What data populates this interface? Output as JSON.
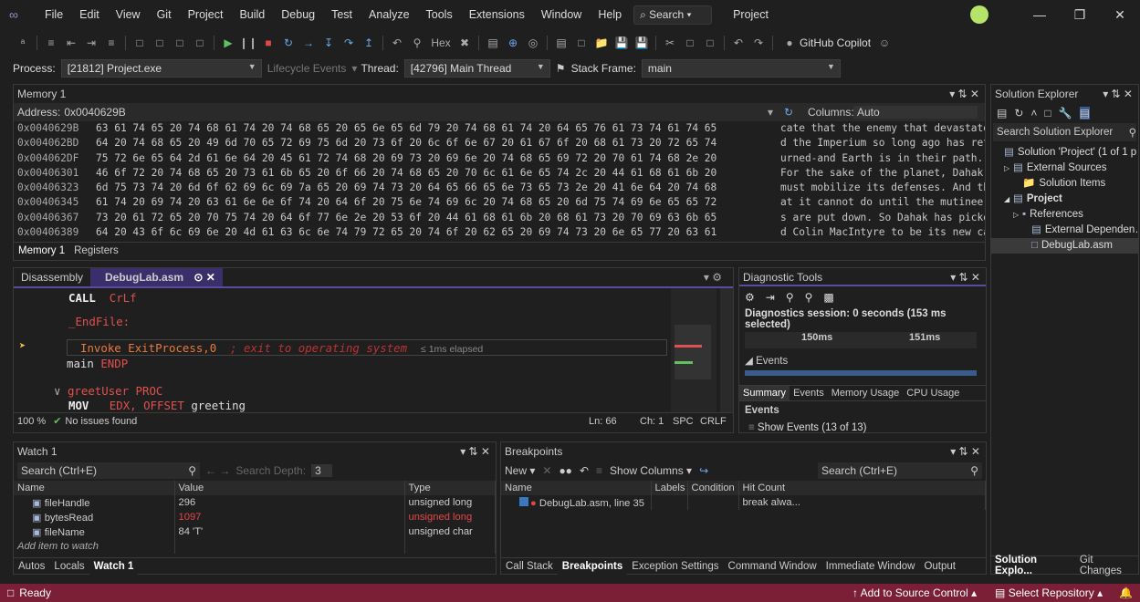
{
  "menubar": {
    "items": [
      "File",
      "Edit",
      "View",
      "Git",
      "Project",
      "Build",
      "Debug",
      "Test",
      "Analyze",
      "Tools",
      "Extensions",
      "Window",
      "Help"
    ],
    "search": "⌕ Search ▾",
    "project": "Project"
  },
  "toolbar": {
    "hex": "Hex",
    "copilot": "GitHub Copilot"
  },
  "procbar": {
    "process_label": "Process:",
    "process_value": "[21812] Project.exe",
    "lifecycle": "Lifecycle Events",
    "thread_label": "Thread:",
    "thread_value": "[42796] Main Thread",
    "frame_label": "Stack Frame:",
    "frame_value": "main"
  },
  "memory": {
    "title": "Memory 1",
    "address_label": "Address:",
    "address_value": "0x0040629B",
    "columns_label": "Columns:",
    "columns_value": "Auto",
    "rows": [
      {
        "addr": "0x0040629B",
        "hex": "63 61 74 65 20 74 68 61 74 20 74 68 65 20 65 6e 65 6d 79 20 74 68 61 74 20 64 65 76 61 73 74 61 74 65",
        "text": "cate that the enemy that devastate"
      },
      {
        "addr": "0x004062BD",
        "hex": "64 20 74 68 65 20 49 6d 70 65 72 69 75 6d 20 73 6f 20 6c 6f 6e 67 20 61 67 6f 20 68 61 73 20 72 65 74",
        "text": "d the Imperium so long ago has ret"
      },
      {
        "addr": "0x004062DF",
        "hex": "75 72 6e 65 64 2d 61 6e 64 20 45 61 72 74 68 20 69 73 20 69 6e 20 74 68 65 69 72 20 70 61 74 68 2e 20",
        "text": "urned-and Earth is in their path. "
      },
      {
        "addr": "0x00406301",
        "hex": "46 6f 72 20 74 68 65 20 73 61 6b 65 20 6f 66 20 74 68 65 20 70 6c 61 6e 65 74 2c 20 44 61 68 61 6b 20",
        "text": "For the sake of the planet, Dahak "
      },
      {
        "addr": "0x00406323",
        "hex": "6d 75 73 74 20 6d 6f 62 69 6c 69 7a 65 20 69 74 73 20 64 65 66 65 6e 73 65 73 2e 20 41 6e 64 20 74 68",
        "text": "must mobilize its defenses. And th"
      },
      {
        "addr": "0x00406345",
        "hex": "61 74 20 69 74 20 63 61 6e 6e 6f 74 20 64 6f 20 75 6e 74 69 6c 20 74 68 65 20 6d 75 74 69 6e 65 65 72",
        "text": "at it cannot do until the mutineer"
      },
      {
        "addr": "0x00406367",
        "hex": "73 20 61 72 65 20 70 75 74 20 64 6f 77 6e 2e 20 53 6f 20 44 61 68 61 6b 20 68 61 73 20 70 69 63 6b 65",
        "text": "s are put down. So Dahak has picke"
      },
      {
        "addr": "0x00406389",
        "hex": "64 20 43 6f 6c 69 6e 20 4d 61 63 6c 6e 74 79 72 65 20 74 6f 20 62 65 20 69 74 73 20 6e 65 77 20 63 61",
        "text": "d Colin MacIntyre to be its new ca"
      },
      {
        "addr": "0x004063AB",
        "hex": "70 74 61 69 6e 2e 20 4e 6f 77 20 4d 61 63 49 6e 74 79 72 65 20 6d 75 73 74 20 6d 6f 62 69 6c 69 7a 65",
        "text": "ptain. Now MacIntyre must mobilize"
      }
    ],
    "tabs": [
      "Memory 1",
      "Registers"
    ]
  },
  "editor": {
    "tabs": [
      "Disassembly",
      "DebugLab.asm"
    ],
    "lines": [
      {
        "indent": 1,
        "kw": "CALL",
        "arg": "CrLf",
        "cls": "red"
      },
      {
        "indent": 1,
        "label": "_EndFile:"
      },
      {
        "indent": 1,
        "kw2": "Invoke",
        "arg": "ExitProcess,0",
        "comment": "; exit to operating system",
        "elapsed": "≤ 1ms elapsed"
      },
      {
        "indent": 0,
        "main": "main",
        "endp": "ENDP"
      },
      {
        "indent": 0,
        "proc": "greetUser",
        "pkw": "PROC"
      },
      {
        "indent": 1,
        "kw": "MOV",
        "arg": "EDX,",
        "off": "OFFSET",
        "name": "greeting"
      }
    ],
    "zoom": "100 %",
    "issues": "No issues found",
    "ln": "Ln: 66",
    "ch": "Ch: 1",
    "spc": "SPC",
    "crlf": "CRLF"
  },
  "diag": {
    "title": "Diagnostic Tools",
    "session": "Diagnostics session: 0 seconds (153 ms selected)",
    "t1": "150ms",
    "t2": "151ms",
    "events": "Events",
    "tabs": [
      "Summary",
      "Events",
      "Memory Usage",
      "CPU Usage"
    ],
    "events2": "Events",
    "show": "Show Events (13 of 13)"
  },
  "solution": {
    "title": "Solution Explorer",
    "search": "Search Solution Explorer",
    "items": [
      {
        "label": "Solution 'Project' (1 of 1 p",
        "lvl": 0
      },
      {
        "label": "External Sources",
        "lvl": 1
      },
      {
        "label": "Solution Items",
        "lvl": 2
      },
      {
        "label": "Project",
        "lvl": 1
      },
      {
        "label": "References",
        "lvl": 2
      },
      {
        "label": "External Dependen…",
        "lvl": 3
      },
      {
        "label": "DebugLab.asm",
        "lvl": 3
      }
    ],
    "tabs": [
      "Solution Explo...",
      "Git Changes"
    ]
  },
  "watch": {
    "title": "Watch 1",
    "search": "Search (Ctrl+E)",
    "depth_label": "Search Depth:",
    "depth": "3",
    "headers": [
      "Name",
      "Value",
      "Type"
    ],
    "rows": [
      {
        "name": "fileHandle",
        "value": "296",
        "type": "unsigned long",
        "changed": false
      },
      {
        "name": "bytesRead",
        "value": "1097",
        "type": "unsigned long",
        "changed": true
      },
      {
        "name": "fileName",
        "value": "84 'T'",
        "type": "unsigned char",
        "changed": false
      }
    ],
    "add": "Add item to watch",
    "tabs": [
      "Autos",
      "Locals",
      "Watch 1"
    ]
  },
  "breakpoints": {
    "title": "Breakpoints",
    "new": "New ▾",
    "showcols": "Show Columns ▾",
    "search": "Search (Ctrl+E)",
    "headers": [
      "Name",
      "Labels",
      "Condition",
      "Hit Count"
    ],
    "rows": [
      {
        "name": "DebugLab.asm, line 35",
        "hit": "break alwa..."
      }
    ],
    "tabs": [
      "Call Stack",
      "Breakpoints",
      "Exception Settings",
      "Command Window",
      "Immediate Window",
      "Output"
    ]
  },
  "status": {
    "ready": "Ready",
    "source": "Add to Source Control ▴",
    "repo": "Select Repository ▴"
  }
}
